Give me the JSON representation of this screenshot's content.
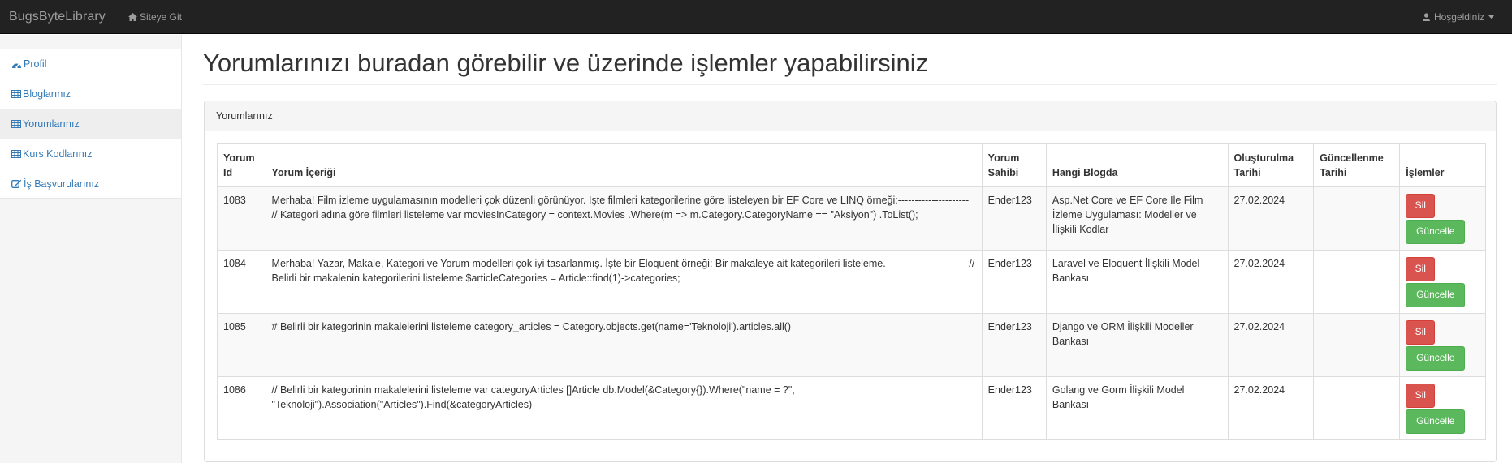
{
  "navbar": {
    "brand": "BugsByteLibrary",
    "site_link": "Siteye Git",
    "user_menu": "Hoşgeldiniz"
  },
  "sidebar": {
    "items": [
      {
        "label": "Profil",
        "icon": "dashboard-icon"
      },
      {
        "label": "Bloglarınız",
        "icon": "table-icon"
      },
      {
        "label": "Yorumlarınız",
        "icon": "table-icon"
      },
      {
        "label": "Kurs Kodlarınız",
        "icon": "table-icon"
      },
      {
        "label": "İş Başvurularınız",
        "icon": "edit-icon"
      }
    ]
  },
  "main": {
    "title": "Yorumlarınızı buradan görebilir ve üzerinde işlemler yapabilirsiniz",
    "panel_title": "Yorumlarınız",
    "columns": [
      "Yorum Id",
      "Yorum İçeriği",
      "Yorum Sahibi",
      "Hangi Blogda",
      "Oluşturulma Tarihi",
      "Güncellenme Tarihi",
      "İşlemler"
    ],
    "rows": [
      {
        "id": "1083",
        "content": "Merhaba! Film izleme uygulamasının modelleri çok düzenli görünüyor. İşte filmleri kategorilerine göre listeleyen bir EF Core ve LINQ örneği:--------------------- // Kategori adına göre filmleri listeleme var moviesInCategory = context.Movies .Where(m => m.Category.CategoryName == \"Aksiyon\") .ToList();",
        "owner": "Ender123",
        "blog": "Asp.Net Core ve EF Core İle Film İzleme Uygulaması: Modeller ve İlişkili Kodlar",
        "created": "27.02.2024",
        "updated": "",
        "delete_label": "Sil",
        "update_label": "Güncelle"
      },
      {
        "id": "1084",
        "content": "Merhaba! Yazar, Makale, Kategori ve Yorum modelleri çok iyi tasarlanmış. İşte bir Eloquent örneği: Bir makaleye ait kategorileri listeleme. ----------------------- // Belirli bir makalenin kategorilerini listeleme $articleCategories = Article::find(1)->categories;",
        "owner": "Ender123",
        "blog": "Laravel ve Eloquent İlişkili Model Bankası",
        "created": "27.02.2024",
        "updated": "",
        "delete_label": "Sil",
        "update_label": "Güncelle"
      },
      {
        "id": "1085",
        "content": "# Belirli bir kategorinin makalelerini listeleme category_articles = Category.objects.get(name='Teknoloji').articles.all()",
        "owner": "Ender123",
        "blog": "Django ve ORM İlişkili Modeller Bankası",
        "created": "27.02.2024",
        "updated": "",
        "delete_label": "Sil",
        "update_label": "Güncelle"
      },
      {
        "id": "1086",
        "content": "// Belirli bir kategorinin makalelerini listeleme var categoryArticles []Article db.Model(&Category{}).Where(\"name = ?\", \"Teknoloji\").Association(\"Articles\").Find(&categoryArticles)",
        "owner": "Ender123",
        "blog": "Golang ve Gorm İlişkili Model Bankası",
        "created": "27.02.2024",
        "updated": "",
        "delete_label": "Sil",
        "update_label": "Güncelle"
      }
    ]
  },
  "colors": {
    "navbar_bg": "#222222",
    "link": "#337ab7",
    "danger": "#d9534f",
    "success": "#5cb85c"
  }
}
